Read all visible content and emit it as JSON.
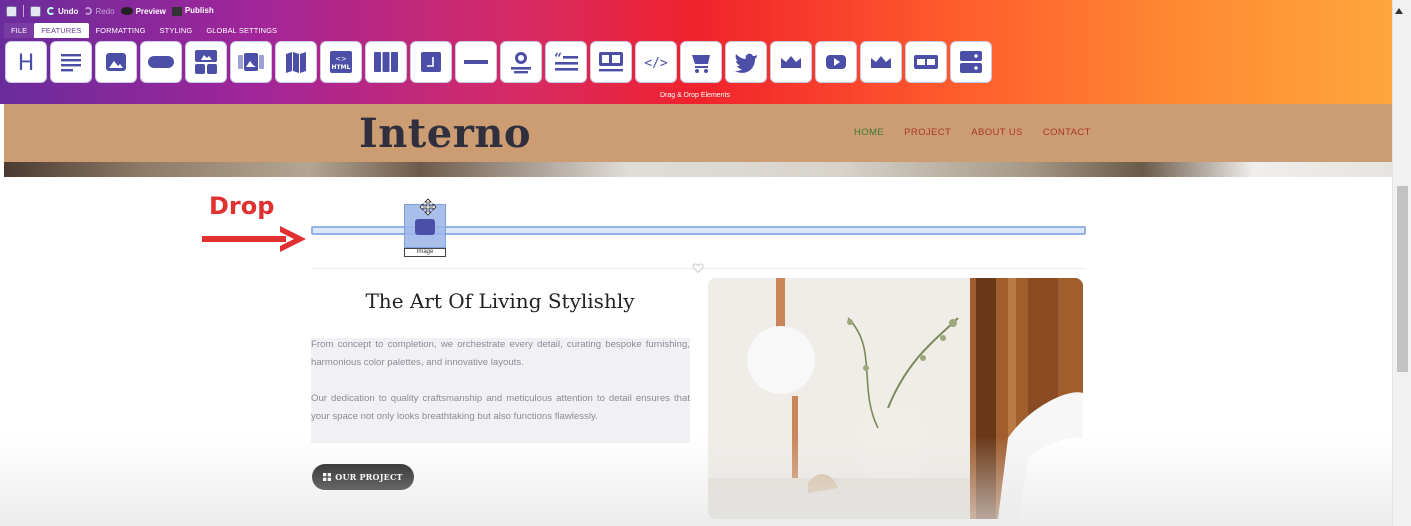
{
  "quick_access": {
    "undo_label": "Undo",
    "redo_label": "Redo",
    "preview_label": "Preview",
    "publish_label": "Publish"
  },
  "ribbon_tabs": [
    {
      "label": "FILE"
    },
    {
      "label": "FEATURES"
    },
    {
      "label": "FORMATTING"
    },
    {
      "label": "STYLING"
    },
    {
      "label": "GLOBAL SETTINGS"
    }
  ],
  "active_tab": "FEATURES",
  "tools": [
    {
      "icon": "heading-icon"
    },
    {
      "icon": "paragraph-icon"
    },
    {
      "icon": "image-icon"
    },
    {
      "icon": "button-icon"
    },
    {
      "icon": "gallery-icon"
    },
    {
      "icon": "slider-icon"
    },
    {
      "icon": "map-icon"
    },
    {
      "icon": "html-icon"
    },
    {
      "icon": "columns-icon"
    },
    {
      "icon": "container-icon"
    },
    {
      "icon": "divider-icon"
    },
    {
      "icon": "testimonial-icon"
    },
    {
      "icon": "quote-icon"
    },
    {
      "icon": "media-text-icon"
    },
    {
      "icon": "code-icon"
    },
    {
      "icon": "cart-icon"
    },
    {
      "icon": "twitter-icon"
    },
    {
      "icon": "crown-icon"
    },
    {
      "icon": "youtube-icon"
    },
    {
      "icon": "crown-icon"
    },
    {
      "icon": "input-icon"
    },
    {
      "icon": "form-icon"
    }
  ],
  "ribbon_caption": "Drag & Drop Elements",
  "site": {
    "logo": "Interno",
    "nav": [
      "HOME",
      "PROJECT",
      "ABOUT US",
      "CONTACT"
    ]
  },
  "drop": {
    "label": "Drop",
    "ghost_label": "Image"
  },
  "content": {
    "title": "The Art Of Living Stylishly",
    "paragraph1": "From concept to completion, we orchestrate every detail, curating bespoke furnishing, harmonious color palettes, and innovative layouts.",
    "paragraph2": "Our dedication to quality craftsmanship and meticulous attention to detail ensures that your space not only looks breathtaking but also functions flawlessly.",
    "button": "OUR PROJECT"
  },
  "colors": {
    "header_bg": "#cc9c72",
    "tool_icon": "#4b4fa8",
    "drop_red": "#e0302f"
  }
}
